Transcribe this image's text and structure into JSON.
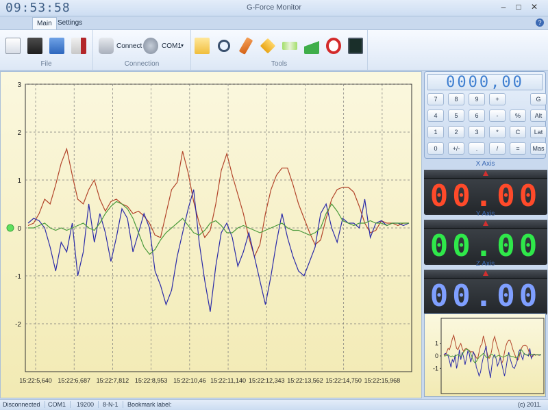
{
  "titlebar": {
    "clock": "09:53:58",
    "title": "G-Force Monitor"
  },
  "tabs": [
    {
      "label": "Main"
    },
    {
      "label": "Settings"
    }
  ],
  "ribbon": {
    "groups": {
      "file": "File",
      "connection": "Connection",
      "tools": "Tools"
    },
    "connect_label": "Connect",
    "port_label": "COM1"
  },
  "calculator": {
    "display": "0000,00",
    "keys": [
      "7",
      "8",
      "9",
      "+",
      "G",
      "4",
      "5",
      "6",
      "-",
      "%",
      "Alt",
      "1",
      "2",
      "3",
      "*",
      "C",
      "Lat",
      "0",
      "+/-",
      ".",
      "/",
      "=",
      "Mas"
    ]
  },
  "axes": {
    "x": {
      "label": "X Axis",
      "value": "00.00",
      "color": "#ff4a2a"
    },
    "y": {
      "label": "Y Axis",
      "value": "00.00",
      "color": "#2fe84a"
    },
    "z": {
      "label": "Z Axis",
      "value": "00.00",
      "color": "#7f9fff"
    }
  },
  "status": {
    "conn": "Disconnected",
    "port": "COM1",
    "baud": "19200",
    "frame": "8-N-1",
    "bookmark": "Bookmark label:",
    "copyright": "(c) 2011."
  },
  "chart_data": {
    "type": "line",
    "ylim": [
      -3,
      3
    ],
    "y_ticks": [
      3,
      2,
      1,
      0,
      -1,
      -2
    ],
    "x_ticks": [
      "15:22:5,640",
      "15:22:6,687",
      "15:22:7,812",
      "15:22:8,953",
      "15:22:10,46",
      "15:22:11,140",
      "15:22:12,343",
      "15:22:13,562",
      "15:22:14,750",
      "15:22:15,968"
    ],
    "grid": true,
    "series": [
      {
        "color": "#b2442a",
        "values": [
          0.05,
          0.1,
          0.3,
          0.6,
          0.5,
          0.9,
          1.35,
          1.65,
          1.1,
          0.6,
          0.5,
          0.8,
          1.0,
          0.6,
          0.35,
          0.55,
          0.6,
          0.5,
          0.45,
          0.3,
          0.35,
          0.25,
          0.1,
          -0.15,
          -0.2,
          0.3,
          0.8,
          0.95,
          1.6,
          1.15,
          0.55,
          0.1,
          -0.2,
          -0.05,
          0.5,
          1.2,
          1.55,
          1.1,
          0.7,
          0.3,
          -0.2,
          -0.6,
          -0.35,
          0.3,
          0.8,
          1.1,
          1.25,
          1.25,
          0.9,
          0.5,
          0.2,
          -0.1,
          -0.35,
          -0.25,
          0.2,
          0.6,
          0.8,
          0.85,
          0.85,
          0.75,
          0.45,
          0.1,
          -0.1,
          -0.05,
          0.15,
          0.1,
          0.1,
          0.05,
          0.1,
          0.1
        ]
      },
      {
        "color": "#2a2aa8",
        "values": [
          0.1,
          0.2,
          0.15,
          0.0,
          -0.4,
          -0.9,
          -0.3,
          -0.5,
          0.1,
          -1.0,
          -0.5,
          0.5,
          -0.3,
          0.3,
          -0.1,
          -0.7,
          -0.2,
          0.4,
          0.2,
          -0.5,
          -0.1,
          0.3,
          0.0,
          -0.9,
          -1.2,
          -1.6,
          -1.3,
          -0.6,
          -0.1,
          0.4,
          0.8,
          -0.3,
          -1.1,
          -1.75,
          -0.8,
          -0.1,
          0.1,
          -0.2,
          -0.8,
          -0.5,
          -0.1,
          -0.6,
          -1.1,
          -1.6,
          -1.0,
          -0.3,
          0.3,
          -0.2,
          -0.6,
          -0.9,
          -1.0,
          -0.7,
          -0.4,
          0.3,
          0.5,
          0.0,
          -0.3,
          0.2,
          0.1,
          0.1,
          0.0,
          0.6,
          -0.2,
          0.1,
          0.15,
          0.05,
          0.1,
          0.1,
          0.05,
          0.1
        ]
      },
      {
        "color": "#4a9a3a",
        "values": [
          0.0,
          0.0,
          0.05,
          0.1,
          0.0,
          -0.05,
          0.0,
          -0.05,
          0.0,
          0.05,
          0.1,
          0.0,
          -0.05,
          0.1,
          0.3,
          0.45,
          0.55,
          0.5,
          0.4,
          0.2,
          -0.1,
          -0.4,
          -0.55,
          -0.45,
          -0.25,
          -0.1,
          0.0,
          0.1,
          0.2,
          0.05,
          -0.1,
          -0.15,
          -0.05,
          0.1,
          0.15,
          0.05,
          -0.1,
          -0.1,
          0.0,
          0.05,
          0.0,
          -0.05,
          -0.1,
          -0.05,
          0.0,
          0.05,
          0.1,
          0.0,
          -0.05,
          -0.05,
          -0.1,
          -0.15,
          -0.1,
          0.0,
          0.3,
          0.5,
          0.35,
          0.15,
          0.1,
          0.05,
          0.1,
          0.1,
          0.15,
          0.1,
          0.1,
          0.05,
          0.1,
          0.1,
          0.1,
          0.1
        ]
      }
    ]
  }
}
